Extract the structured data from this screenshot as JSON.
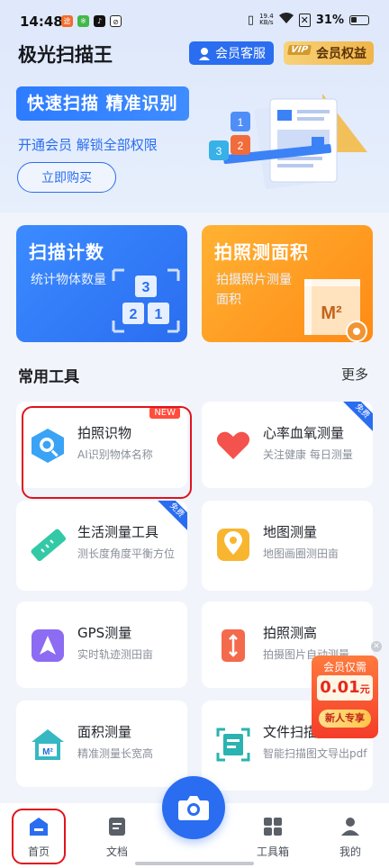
{
  "status_bar": {
    "time": "14:48",
    "net_speed": "19.4",
    "net_unit": "KB/s",
    "battery": "31%"
  },
  "header": {
    "title": "极光扫描王",
    "service_label": "会员客服",
    "vip_tag": "VIP",
    "vip_label": "会员权益"
  },
  "banner": {
    "headline": "快速扫描 精准识别",
    "subtitle": "开通会员 解锁全部权限",
    "buy_label": "立即购买"
  },
  "features": [
    {
      "title": "扫描计数",
      "desc": "统计物体数量"
    },
    {
      "title": "拍照测面积",
      "desc": "拍摄照片测量面积"
    }
  ],
  "tools_section": {
    "title": "常用工具",
    "more": "更多"
  },
  "tools": [
    {
      "name": "拍照识物",
      "desc": "AI识别物体名称",
      "badge": "NEW"
    },
    {
      "name": "心率血氧测量",
      "desc": "关注健康 每日测量",
      "badge": "免费"
    },
    {
      "name": "生活测量工具",
      "desc": "测长度角度平衡方位",
      "badge": "免费"
    },
    {
      "name": "地图测量",
      "desc": "地图画圈测田亩",
      "badge": ""
    },
    {
      "name": "GPS测量",
      "desc": "实时轨迹测田亩",
      "badge": ""
    },
    {
      "name": "拍照测高",
      "desc": "拍摄图片自动测量",
      "badge": ""
    },
    {
      "name": "面积测量",
      "desc": "精准测量长宽高",
      "badge": ""
    },
    {
      "name": "文件扫描",
      "desc": "智能扫描图文导出pdf",
      "badge": ""
    }
  ],
  "promo": {
    "line1": "会员仅需",
    "price": "0.01",
    "unit": "元",
    "cta": "新人专享"
  },
  "bottom_nav": {
    "home": "首页",
    "docs": "文档",
    "toolbox": "工具箱",
    "mine": "我的"
  },
  "colors": {
    "accent": "#2a6df0",
    "orange": "#ff8a14",
    "highlight": "#e0131e"
  }
}
